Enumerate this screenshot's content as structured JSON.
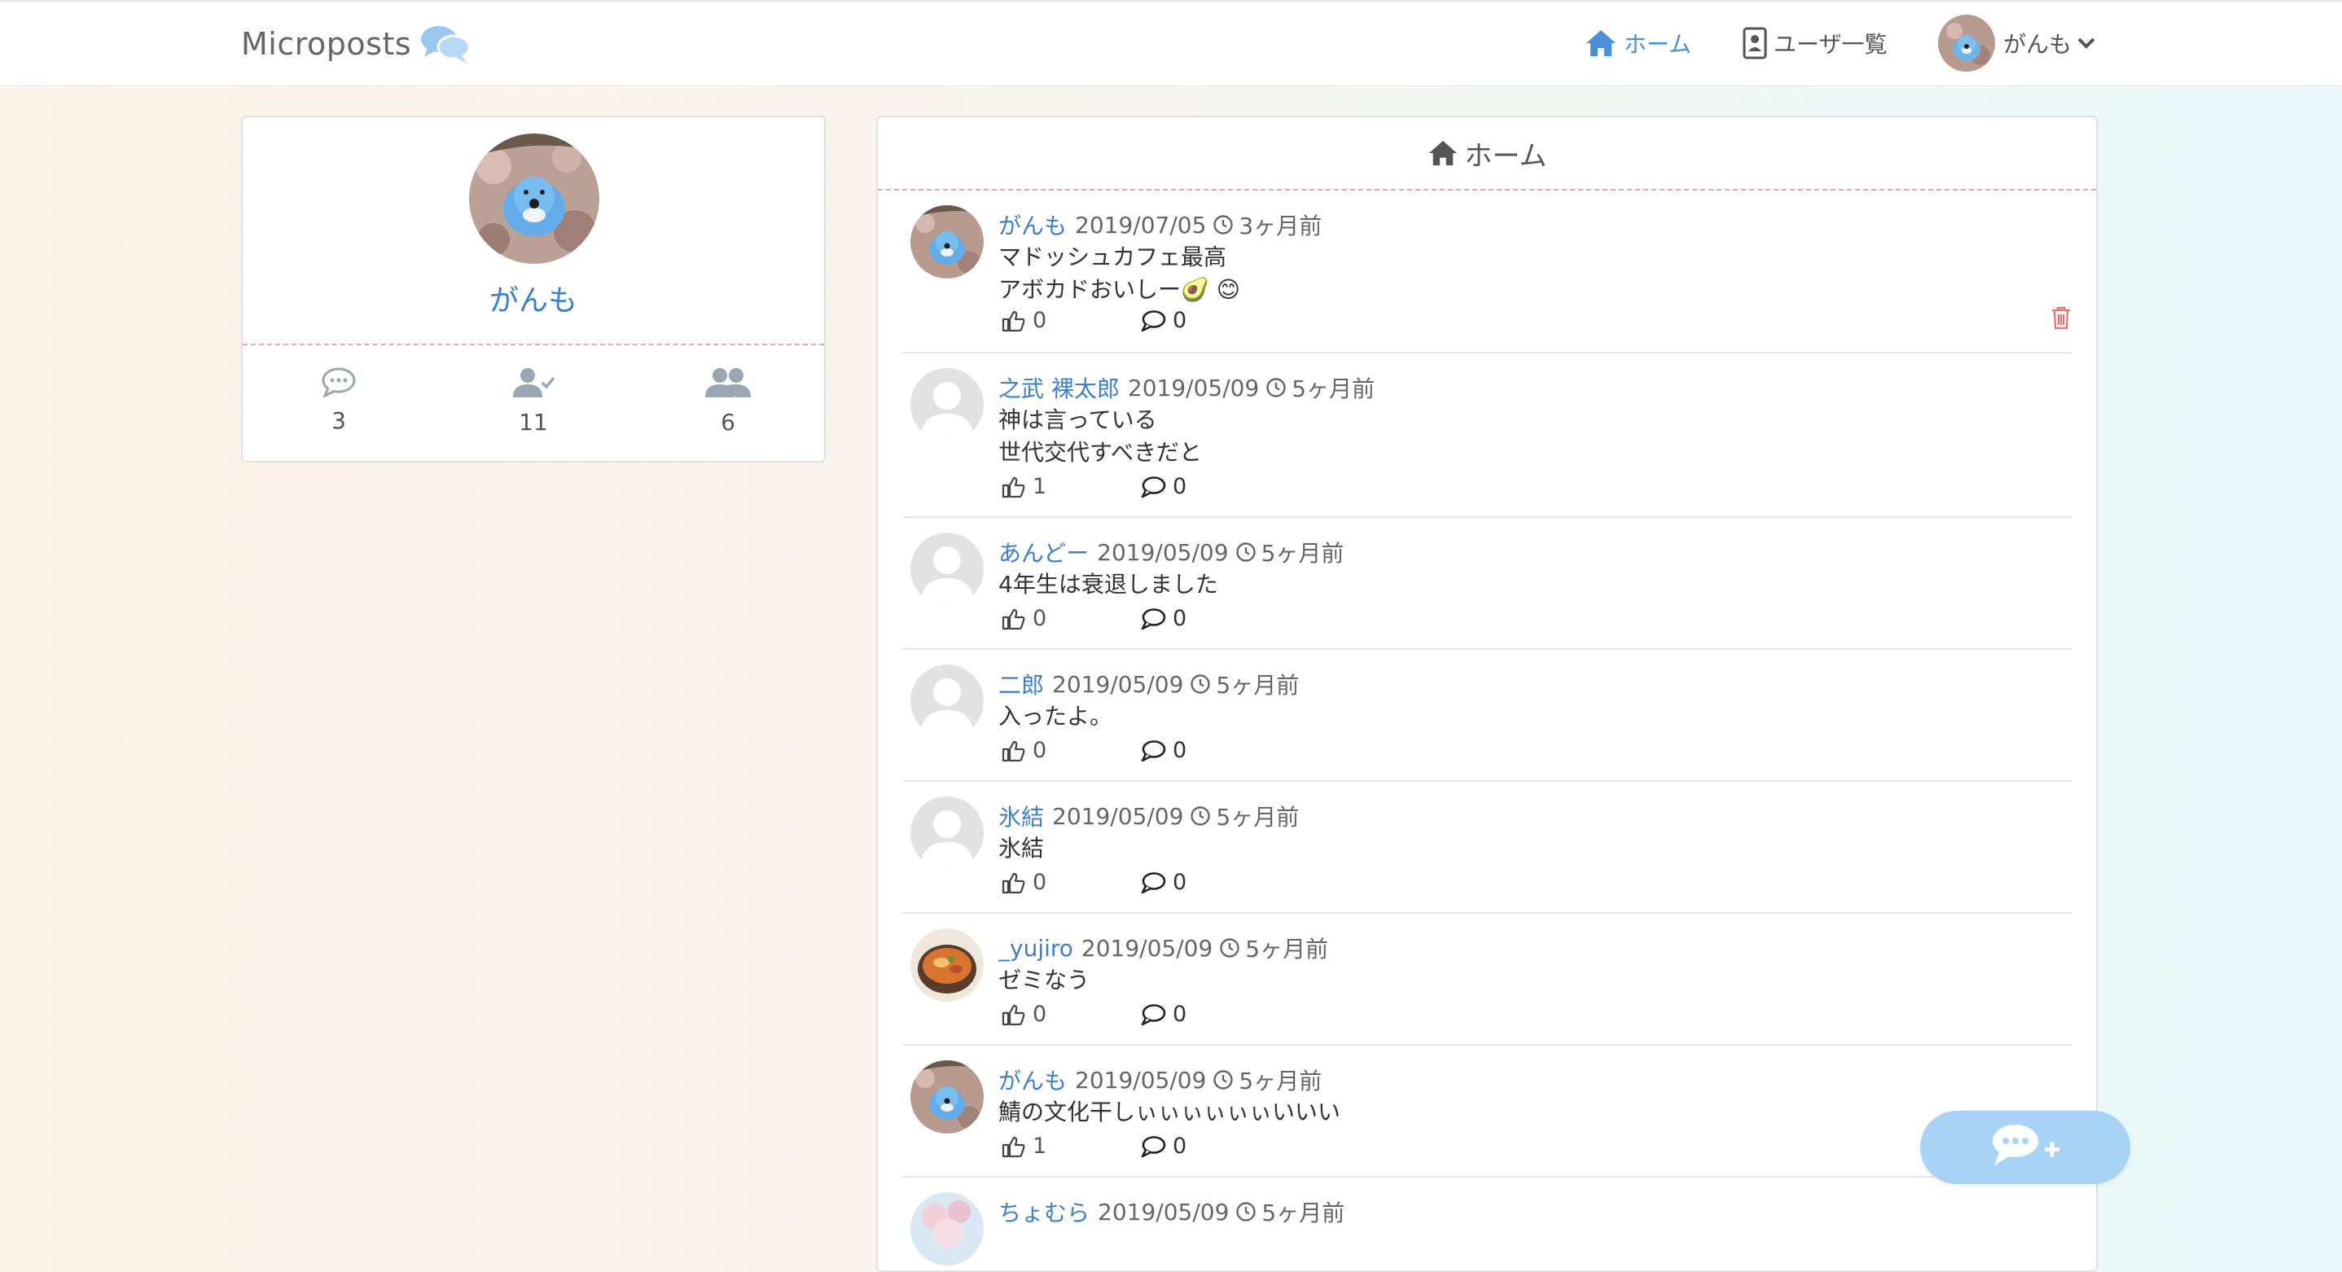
{
  "navbar": {
    "brand": "Microposts",
    "brand_icon": "comments-icon",
    "home_label": "ホーム",
    "users_label": "ユーザ一覧",
    "current_user": "がんも"
  },
  "profile": {
    "name": "がんも",
    "stats": {
      "posts": "3",
      "followings": "11",
      "followers": "6"
    }
  },
  "main": {
    "title": "ホーム",
    "posts": [
      {
        "user": "がんも",
        "date": "2019/07/05",
        "ago": "3ヶ月前",
        "body": "マドッシュカフェ最高\nアボカドおいしー🥑 😊",
        "likes": "0",
        "replies": "0",
        "avatar": "bird",
        "deletable": true
      },
      {
        "user": "之武 裸太郎",
        "date": "2019/05/09",
        "ago": "5ヶ月前",
        "body": "神は言っている\n世代交代すべきだと",
        "likes": "1",
        "replies": "0",
        "avatar": "default",
        "deletable": false
      },
      {
        "user": "あんどー",
        "date": "2019/05/09",
        "ago": "5ヶ月前",
        "body": "4年生は衰退しました",
        "likes": "0",
        "replies": "0",
        "avatar": "default",
        "deletable": false
      },
      {
        "user": "二郎",
        "date": "2019/05/09",
        "ago": "5ヶ月前",
        "body": "入ったよ。",
        "likes": "0",
        "replies": "0",
        "avatar": "default",
        "deletable": false
      },
      {
        "user": "氷結",
        "date": "2019/05/09",
        "ago": "5ヶ月前",
        "body": "氷結",
        "likes": "0",
        "replies": "0",
        "avatar": "default",
        "deletable": false
      },
      {
        "user": "_yujiro",
        "date": "2019/05/09",
        "ago": "5ヶ月前",
        "body": "ゼミなう",
        "likes": "0",
        "replies": "0",
        "avatar": "food",
        "deletable": false
      },
      {
        "user": "がんも",
        "date": "2019/05/09",
        "ago": "5ヶ月前",
        "body": "鯖の文化干しぃぃぃぃぃぃいいい",
        "likes": "1",
        "replies": "0",
        "avatar": "bird",
        "deletable": true
      },
      {
        "user": "ちょむら",
        "date": "2019/05/09",
        "ago": "5ヶ月前",
        "body": "",
        "likes": "",
        "replies": "",
        "avatar": "sky",
        "deletable": false
      }
    ]
  },
  "fab": {
    "icon": "new-post-icon"
  },
  "colors": {
    "link": "#3d7fc8",
    "nav_active": "#4a90d9",
    "divider": "#e8a6a6",
    "fab": "#a9d3f6",
    "trash": "#e57373"
  }
}
